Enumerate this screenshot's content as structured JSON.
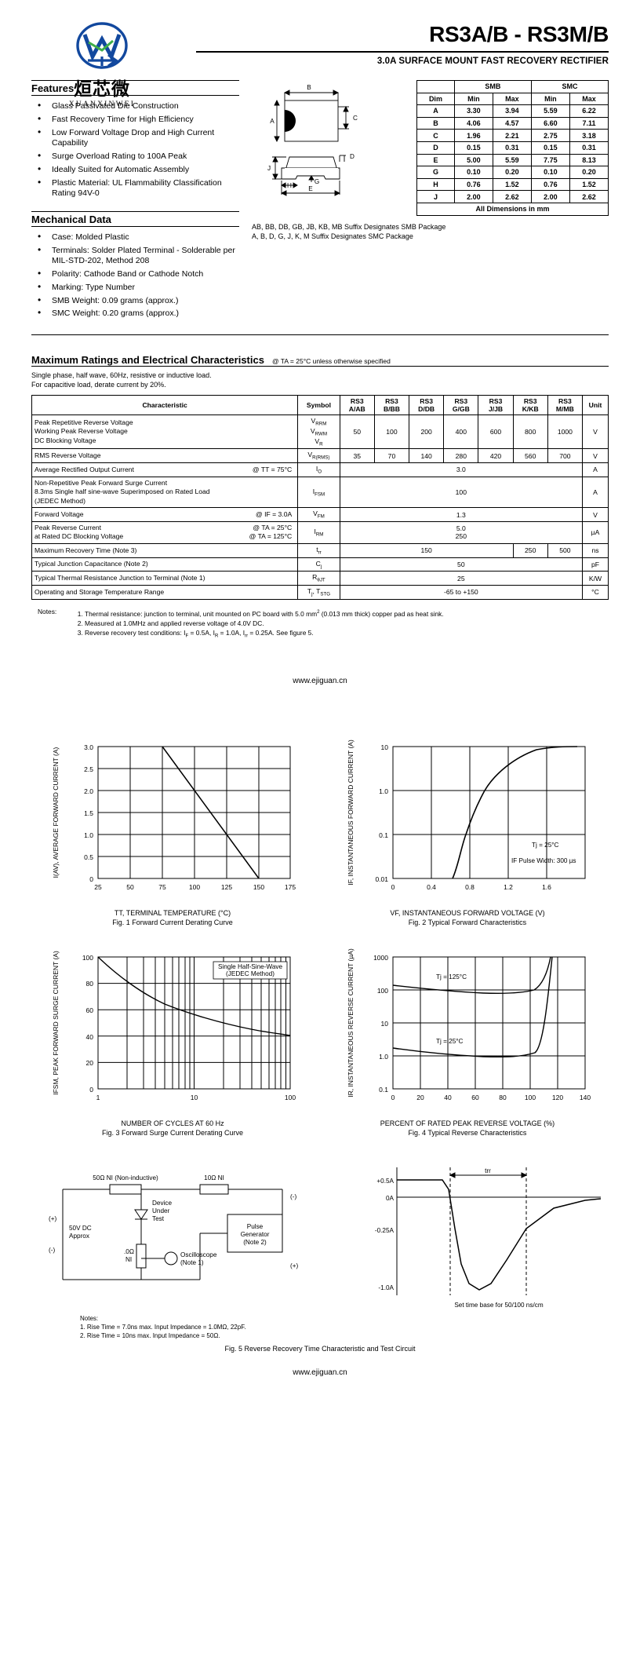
{
  "header": {
    "part_title": "RS3A/B - RS3M/B",
    "subtitle": "3.0A SURFACE MOUNT FAST RECOVERY RECTIFIER",
    "logo_cn": "烜芯微",
    "logo_en": "XUANXINWEI",
    "logo_letters": "XVM"
  },
  "features": {
    "heading": "Features",
    "items": [
      "Glass Passivated Die Construction",
      "Fast Recovery Time for High Efficiency",
      "Low Forward Voltage Drop and High Current Capability",
      "Surge Overload Rating to 100A Peak",
      "Ideally Suited for Automatic Assembly",
      "Plastic Material: UL Flammability Classification Rating 94V-0"
    ]
  },
  "mechanical": {
    "heading": "Mechanical Data",
    "items": [
      "Case: Molded Plastic",
      "Terminals: Solder Plated Terminal - Solderable per MIL-STD-202, Method 208",
      "Polarity: Cathode Band or Cathode Notch",
      "Marking: Type Number",
      "SMB Weight: 0.09 grams (approx.)",
      "SMC Weight: 0.20 grams (approx.)"
    ]
  },
  "dimensions": {
    "group_headers": [
      "SMB",
      "SMC"
    ],
    "columns": [
      "Dim",
      "Min",
      "Max",
      "Min",
      "Max"
    ],
    "rows": [
      [
        "A",
        "3.30",
        "3.94",
        "5.59",
        "6.22"
      ],
      [
        "B",
        "4.06",
        "4.57",
        "6.60",
        "7.11"
      ],
      [
        "C",
        "1.96",
        "2.21",
        "2.75",
        "3.18"
      ],
      [
        "D",
        "0.15",
        "0.31",
        "0.15",
        "0.31"
      ],
      [
        "E",
        "5.00",
        "5.59",
        "7.75",
        "8.13"
      ],
      [
        "G",
        "0.10",
        "0.20",
        "0.10",
        "0.20"
      ],
      [
        "H",
        "0.76",
        "1.52",
        "0.76",
        "1.52"
      ],
      [
        "J",
        "2.00",
        "2.62",
        "2.00",
        "2.62"
      ]
    ],
    "footer": "All Dimensions in mm",
    "labels": {
      "a": "A",
      "b": "B",
      "c": "C",
      "d": "D",
      "e": "E",
      "g": "G",
      "h": "H",
      "j": "J"
    }
  },
  "suffix_note": {
    "line1": "AB, BB, DB, GB, JB, KB, MB Suffix Designates SMB Package",
    "line2": "A, B, D, G, J, K, M Suffix Designates SMC Package"
  },
  "ratings": {
    "title": "Maximum Ratings and Electrical Characteristics",
    "condition": "@ TA = 25°C unless otherwise specified",
    "subtext_1": "Single phase, half wave, 60Hz, resistive or inductive load.",
    "subtext_2": "For capacitive load, derate current by 20%.",
    "headers": {
      "characteristic": "Characteristic",
      "symbol": "Symbol",
      "parts": [
        "RS3\nA/AB",
        "RS3\nB/BB",
        "RS3\nD/DB",
        "RS3\nG/GB",
        "RS3\nJ/JB",
        "RS3\nK/KB",
        "RS3\nM/MB"
      ],
      "part_top": "RS3",
      "part_bottoms": [
        "A/AB",
        "B/BB",
        "D/DB",
        "G/GB",
        "J/JB",
        "K/KB",
        "M/MB"
      ],
      "unit": "Unit"
    },
    "rows": [
      {
        "name": "vrrm",
        "characteristic_lines": [
          "Peak Repetitive Reverse Voltage",
          "Working Peak Reverse Voltage",
          "DC Blocking Voltage"
        ],
        "symbol_lines": [
          "VRRM",
          "VRWM",
          "VR"
        ],
        "values": [
          "50",
          "100",
          "200",
          "400",
          "600",
          "800",
          "1000"
        ],
        "unit": "V"
      },
      {
        "name": "vrms",
        "characteristic_lines": [
          "RMS Reverse Voltage"
        ],
        "symbol_lines": [
          "VR(RMS)"
        ],
        "values": [
          "35",
          "70",
          "140",
          "280",
          "420",
          "560",
          "700"
        ],
        "unit": "V"
      },
      {
        "name": "io",
        "characteristic_lines": [
          "Average Rectified Output Current"
        ],
        "condition": "@ TT = 75°C",
        "symbol_lines": [
          "IO"
        ],
        "span_value": "3.0",
        "unit": "A"
      },
      {
        "name": "ifsm",
        "characteristic_lines": [
          "Non-Repetitive Peak Forward Surge Current",
          "8.3ms Single half sine-wave Superimposed on Rated Load",
          "(JEDEC Method)"
        ],
        "symbol_lines": [
          "IFSM"
        ],
        "span_value": "100",
        "unit": "A"
      },
      {
        "name": "vfm",
        "characteristic_lines": [
          "Forward Voltage"
        ],
        "condition": "@ IF = 3.0A",
        "symbol_lines": [
          "VFM"
        ],
        "span_value": "1.3",
        "unit": "V"
      },
      {
        "name": "irm",
        "characteristic_lines": [
          "Peak Reverse Current",
          "at Rated DC Blocking Voltage"
        ],
        "condition_lines": [
          "@ TA =  25°C",
          "@ TA = 125°C"
        ],
        "symbol_lines": [
          "IRM"
        ],
        "span_value_lines": [
          "5.0",
          "250"
        ],
        "unit": "µA"
      },
      {
        "name": "trr",
        "characteristic_lines": [
          "Maximum Recovery Time (Note 3)"
        ],
        "symbol_lines": [
          "trr"
        ],
        "split_values": [
          "150",
          "250",
          "500"
        ],
        "unit": "ns"
      },
      {
        "name": "cj",
        "characteristic_lines": [
          "Typical Junction Capacitance (Note 2)"
        ],
        "symbol_lines": [
          "Cj"
        ],
        "span_value": "50",
        "unit": "pF"
      },
      {
        "name": "rthjt",
        "characteristic_lines": [
          "Typical Thermal Resistance Junction to Terminal (Note 1)"
        ],
        "symbol_lines": [
          "RθJT"
        ],
        "span_value": "25",
        "unit": "K/W"
      },
      {
        "name": "tjtstg",
        "characteristic_lines": [
          "Operating and Storage Temperature Range"
        ],
        "symbol_lines": [
          "Tj, TSTG"
        ],
        "span_value": "-65 to +150",
        "unit": "°C"
      }
    ]
  },
  "notes": {
    "label": "Notes:",
    "items": [
      "Thermal resistance: junction to terminal, unit mounted on PC board with 5.0 mm2 (0.013 mm thick) copper pad as heat sink.",
      "Measured at 1.0MHz and applied reverse voltage of 4.0V DC.",
      "Reverse recovery test conditions: IF = 0.5A, IR = 1.0A, Irr = 0.25A. See figure 5."
    ]
  },
  "website": "www.ejiguan.cn",
  "website_footer": "www.ejiguan.cn",
  "chart_data": [
    {
      "type": "line",
      "name": "fig1",
      "title": "Fig. 1  Forward Current Derating Curve",
      "xlabel": "TT, TERMINAL TEMPERATURE (°C)",
      "ylabel": "I(AV), AVERAGE FORWARD CURRENT (A)",
      "xticks": [
        "25",
        "50",
        "75",
        "100",
        "125",
        "150",
        "175"
      ],
      "yticks": [
        "0",
        "0.5",
        "1.0",
        "1.5",
        "2.0",
        "2.5",
        "3.0"
      ],
      "xlim": [
        25,
        175
      ],
      "ylim": [
        0,
        3.0
      ],
      "grid": true,
      "series": [
        {
          "name": "derating",
          "x": [
            75,
            150
          ],
          "y": [
            3.0,
            0
          ]
        }
      ]
    },
    {
      "type": "line",
      "name": "fig2",
      "title": "Fig. 2  Typical Forward Characteristics",
      "xlabel": "VF, INSTANTANEOUS FORWARD VOLTAGE (V)",
      "ylabel": "IF, INSTANTANEOUS FORWARD CURRENT (A)",
      "xticks": [
        "0",
        "0.4",
        "0.8",
        "1.2",
        "1.6"
      ],
      "yticks": [
        "0.01",
        "0.1",
        "1.0",
        "10"
      ],
      "xlim": [
        0,
        2.0
      ],
      "ylim": [
        0.01,
        10
      ],
      "yscale": "log",
      "grid": true,
      "annotations": [
        "Tj = 25°C",
        "IF Pulse Width: 300 µs"
      ],
      "series": [
        {
          "name": "forward",
          "x": [
            0.62,
            0.72,
            0.85,
            0.98,
            1.12,
            1.3,
            1.55,
            1.8
          ],
          "y": [
            0.01,
            0.03,
            0.1,
            0.3,
            1.0,
            3.0,
            7.0,
            10
          ]
        }
      ]
    },
    {
      "type": "line",
      "name": "fig3",
      "title": "Fig. 3  Forward Surge Current Derating Curve",
      "xlabel": "NUMBER OF CYCLES AT 60 Hz",
      "ylabel": "IFSM, PEAK FORWARD SURGE CURRENT (A)",
      "xticks": [
        "1",
        "10",
        "100"
      ],
      "yticks": [
        "0",
        "20",
        "40",
        "60",
        "80",
        "100"
      ],
      "xlim": [
        1,
        100
      ],
      "ylim": [
        0,
        100
      ],
      "xscale": "log",
      "grid": true,
      "annotations": [
        "Single Half-Sine-Wave",
        "(JEDEC Method)"
      ],
      "series": [
        {
          "name": "surge",
          "x": [
            1,
            2,
            4,
            8,
            10,
            20,
            40,
            60,
            100
          ],
          "y": [
            100,
            82,
            68,
            58,
            55,
            46,
            40,
            37,
            35
          ]
        }
      ]
    },
    {
      "type": "line",
      "name": "fig4",
      "title": "Fig. 4  Typical Reverse Characteristics",
      "xlabel": "PERCENT OF RATED PEAK REVERSE VOLTAGE (%)",
      "ylabel": "IR, INSTANTANEOUS REVERSE CURRENT (µA)",
      "xticks": [
        "0",
        "20",
        "40",
        "60",
        "80",
        "100",
        "120",
        "140"
      ],
      "yticks": [
        "0.1",
        "1.0",
        "10",
        "100",
        "1000"
      ],
      "xlim": [
        0,
        140
      ],
      "ylim": [
        0.1,
        1000
      ],
      "yscale": "log",
      "grid": true,
      "annotations": [
        "Tj = 125°C",
        "Tj = 25°C"
      ],
      "series": [
        {
          "name": "tj125",
          "x": [
            0,
            20,
            40,
            60,
            80,
            100,
            110,
            118,
            122
          ],
          "y": [
            200,
            170,
            150,
            140,
            135,
            140,
            180,
            400,
            1000
          ]
        },
        {
          "name": "tj25",
          "x": [
            0,
            20,
            40,
            60,
            80,
            100,
            110,
            118,
            122
          ],
          "y": [
            2.0,
            1.5,
            1.2,
            1.05,
            1.0,
            1.0,
            1.2,
            5,
            1000
          ]
        }
      ]
    }
  ],
  "fig5": {
    "caption": "Fig. 5  Reverse Recovery Time Characteristic and Test Circuit",
    "circuit": {
      "r_noninductive": "50Ω NI (Non-inductive)",
      "r_10": "10Ω NI",
      "dut_lines": [
        "Device",
        "Under",
        "Test"
      ],
      "supply": "50V DC",
      "supply2": "Approx",
      "pulse_gen_lines": [
        "Pulse",
        "Generator",
        "(Note 2)"
      ],
      "scope_lines": [
        ".0Ω",
        "NI",
        "Oscilloscope",
        "(Note 1)"
      ],
      "plus_left": "(+)",
      "minus_left": "(-)",
      "minus_right": "(-)",
      "plus_right": "(+)"
    },
    "circuit_notes": {
      "label": "Notes:",
      "items": [
        "1. Rise Time = 7.0ns max.  Input Impedance = 1.0MΩ, 22pF.",
        "2. Rise Time = 10ns max.  Input Impedance = 50Ω."
      ]
    },
    "waveform": {
      "yticks": [
        "+0.5A",
        "0A",
        "-0.25A",
        "-1.0A"
      ],
      "label_trr": "trr",
      "timebase": "Set time base for 50/100 ns/cm"
    }
  }
}
